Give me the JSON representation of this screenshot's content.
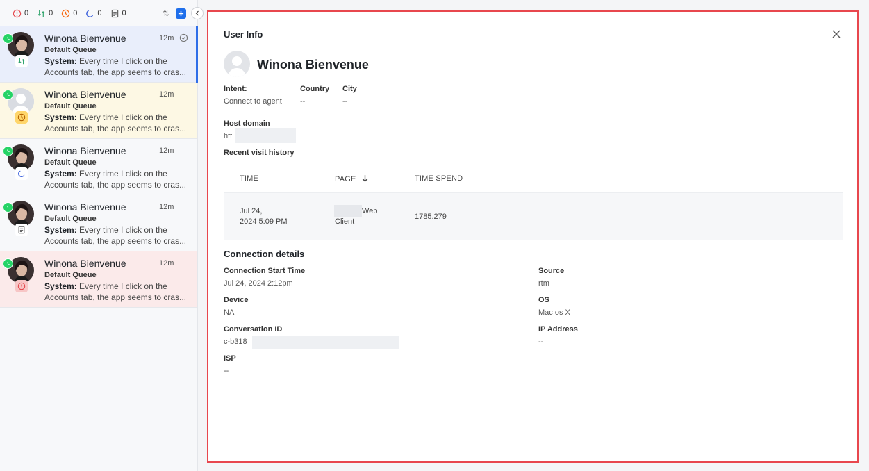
{
  "topbar": {
    "counters": [
      {
        "icon": "alert-circle-icon",
        "color": "#e5484d",
        "value": "0"
      },
      {
        "icon": "transfer-icon",
        "color": "#30a46c",
        "value": "0"
      },
      {
        "icon": "clock-alert-icon",
        "color": "#f76b15",
        "value": "0"
      },
      {
        "icon": "moon-icon",
        "color": "#3e63dd",
        "value": "0"
      },
      {
        "icon": "note-icon",
        "color": "#555",
        "value": "0"
      }
    ],
    "sort_symbol": "⇅"
  },
  "conversations": [
    {
      "name": "Winona Bienvenue",
      "time": "12m",
      "queue": "Default Queue",
      "sender": "System:",
      "msg1": "Every time I click on the",
      "msg2": "Accounts tab, the app seems to cras...",
      "status": "transfer",
      "theme": "active"
    },
    {
      "name": "Winona Bienvenue",
      "time": "12m",
      "queue": "Default Queue",
      "sender": "System:",
      "msg1": "Every time I click on the",
      "msg2": "Accounts tab, the app seems to cras...",
      "status": "clock",
      "theme": "yellow"
    },
    {
      "name": "Winona Bienvenue",
      "time": "12m",
      "queue": "Default Queue",
      "sender": "System:",
      "msg1": "Every time I click on the",
      "msg2": "Accounts tab, the app seems to cras...",
      "status": "moon",
      "theme": "plain"
    },
    {
      "name": "Winona Bienvenue",
      "time": "12m",
      "queue": "Default Queue",
      "sender": "System:",
      "msg1": "Every time I click on the",
      "msg2": "Accounts tab, the app seems to cras...",
      "status": "note",
      "theme": "plain"
    },
    {
      "name": "Winona Bienvenue",
      "time": "12m",
      "queue": "Default Queue",
      "sender": "System:",
      "msg1": "Every time I click on the",
      "msg2": "Accounts tab, the app seems to cras...",
      "status": "alert",
      "theme": "red"
    }
  ],
  "user_info": {
    "title": "User Info",
    "name": "Winona Bienvenue",
    "intent_label": "Intent:",
    "intent_value": "Connect to agent",
    "country_label": "Country",
    "country_value": "--",
    "city_label": "City",
    "city_value": "--",
    "host_domain_label": "Host domain",
    "host_domain_value": "htt",
    "recent_visit_label": "Recent visit history"
  },
  "visit_table": {
    "headers": {
      "time": "TIME",
      "page": "PAGE",
      "time_spend": "TIME SPEND"
    },
    "rows": [
      {
        "time_line1": "Jul 24,",
        "time_line2": "2024 5:09 PM",
        "page_line1": "Web",
        "page_line2": "Client",
        "time_spend": "1785.279"
      }
    ]
  },
  "connection": {
    "title": "Connection details",
    "start_time_label": "Connection Start Time",
    "start_time_value": "Jul 24, 2024 2:12pm",
    "source_label": "Source",
    "source_value": "rtm",
    "device_label": "Device",
    "device_value": "NA",
    "os_label": "OS",
    "os_value": "Mac os X",
    "conv_id_label": "Conversation ID",
    "conv_id_value": "c-b318",
    "ip_label": "IP Address",
    "ip_value": "--",
    "isp_label": "ISP",
    "isp_value": "--"
  },
  "colors": {
    "accent": "#1f6feb",
    "highlight_border": "#e8474e",
    "active_row": "#e9eefb",
    "whatsapp": "#25d366"
  }
}
